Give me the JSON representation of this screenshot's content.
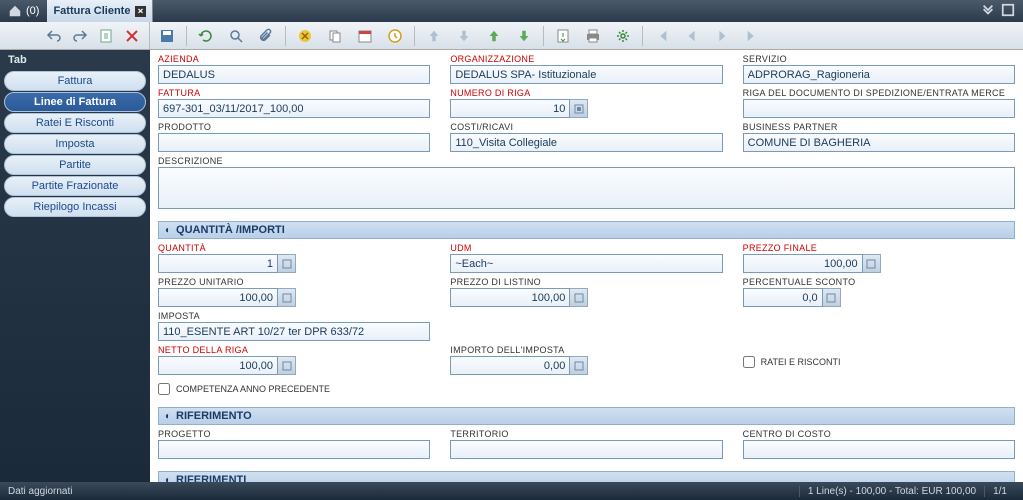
{
  "topbar": {
    "home_count": "(0)",
    "tab_title": "Fattura Cliente"
  },
  "sidebar": {
    "heading": "Tab",
    "items": [
      {
        "label": "Fattura"
      },
      {
        "label": "Linee di Fattura"
      },
      {
        "label": "Ratei E Risconti"
      },
      {
        "label": "Imposta"
      },
      {
        "label": "Partite"
      },
      {
        "label": "Partite Frazionate"
      },
      {
        "label": "Riepilogo Incassi"
      }
    ]
  },
  "fields": {
    "azienda": {
      "label": "AZIENDA",
      "value": "DEDALUS"
    },
    "organizzazione": {
      "label": "ORGANIZZAZIONE",
      "value": "DEDALUS SPA- Istituzionale"
    },
    "servizio": {
      "label": "SERVIZIO",
      "value": "ADPRORAG_Ragioneria"
    },
    "fattura": {
      "label": "FATTURA",
      "value": "697-301_03/11/2017_100,00"
    },
    "numero_riga": {
      "label": "NUMERO DI RIGA",
      "value": "10"
    },
    "riga_doc": {
      "label": "RIGA DEL DOCUMENTO DI SPEDIZIONE/ENTRATA MERCE",
      "value": ""
    },
    "prodotto": {
      "label": "PRODOTTO",
      "value": ""
    },
    "costi_ricavi": {
      "label": "COSTI/RICAVI",
      "value": "110_Visita Collegiale"
    },
    "business_partner": {
      "label": "BUSINESS PARTNER",
      "value": "COMUNE DI BAGHERIA"
    },
    "descrizione": {
      "label": "DESCRIZIONE",
      "value": ""
    }
  },
  "section_quantita": {
    "title": "QUANTITÀ /IMPORTI"
  },
  "qf": {
    "quantita": {
      "label": "QUANTITÀ",
      "value": "1"
    },
    "udm": {
      "label": "UDM",
      "value": "~Each~"
    },
    "prezzo_finale": {
      "label": "PREZZO FINALE",
      "value": "100,00"
    },
    "prezzo_unitario": {
      "label": "PREZZO UNITARIO",
      "value": "100,00"
    },
    "prezzo_listino": {
      "label": "PREZZO DI LISTINO",
      "value": "100,00"
    },
    "perc_sconto": {
      "label": "PERCENTUALE SCONTO",
      "value": "0,0"
    },
    "imposta": {
      "label": "IMPOSTA",
      "value": "110_ESENTE ART 10/27 ter DPR 633/72"
    },
    "netto_riga": {
      "label": "NETTO DELLA RIGA",
      "value": "100,00"
    },
    "importo_imposta": {
      "label": "IMPORTO DELL'IMPOSTA",
      "value": "0,00"
    },
    "ratei": {
      "label": "RATEI E RISCONTI"
    },
    "competenza": {
      "label": "COMPETENZA ANNO PRECEDENTE"
    }
  },
  "section_rif": {
    "title": "RIFERIMENTO"
  },
  "rif": {
    "progetto": {
      "label": "PROGETTO",
      "value": ""
    },
    "territorio": {
      "label": "TERRITORIO",
      "value": ""
    },
    "centro_costo": {
      "label": "CENTRO DI COSTO",
      "value": ""
    }
  },
  "section_rif2": {
    "title": "RIFERIMENTI"
  },
  "status": {
    "left": "Dati aggiornati",
    "summary": "1 Line(s) - 100,00 - Total: EUR 100,00",
    "page": "1/1"
  }
}
